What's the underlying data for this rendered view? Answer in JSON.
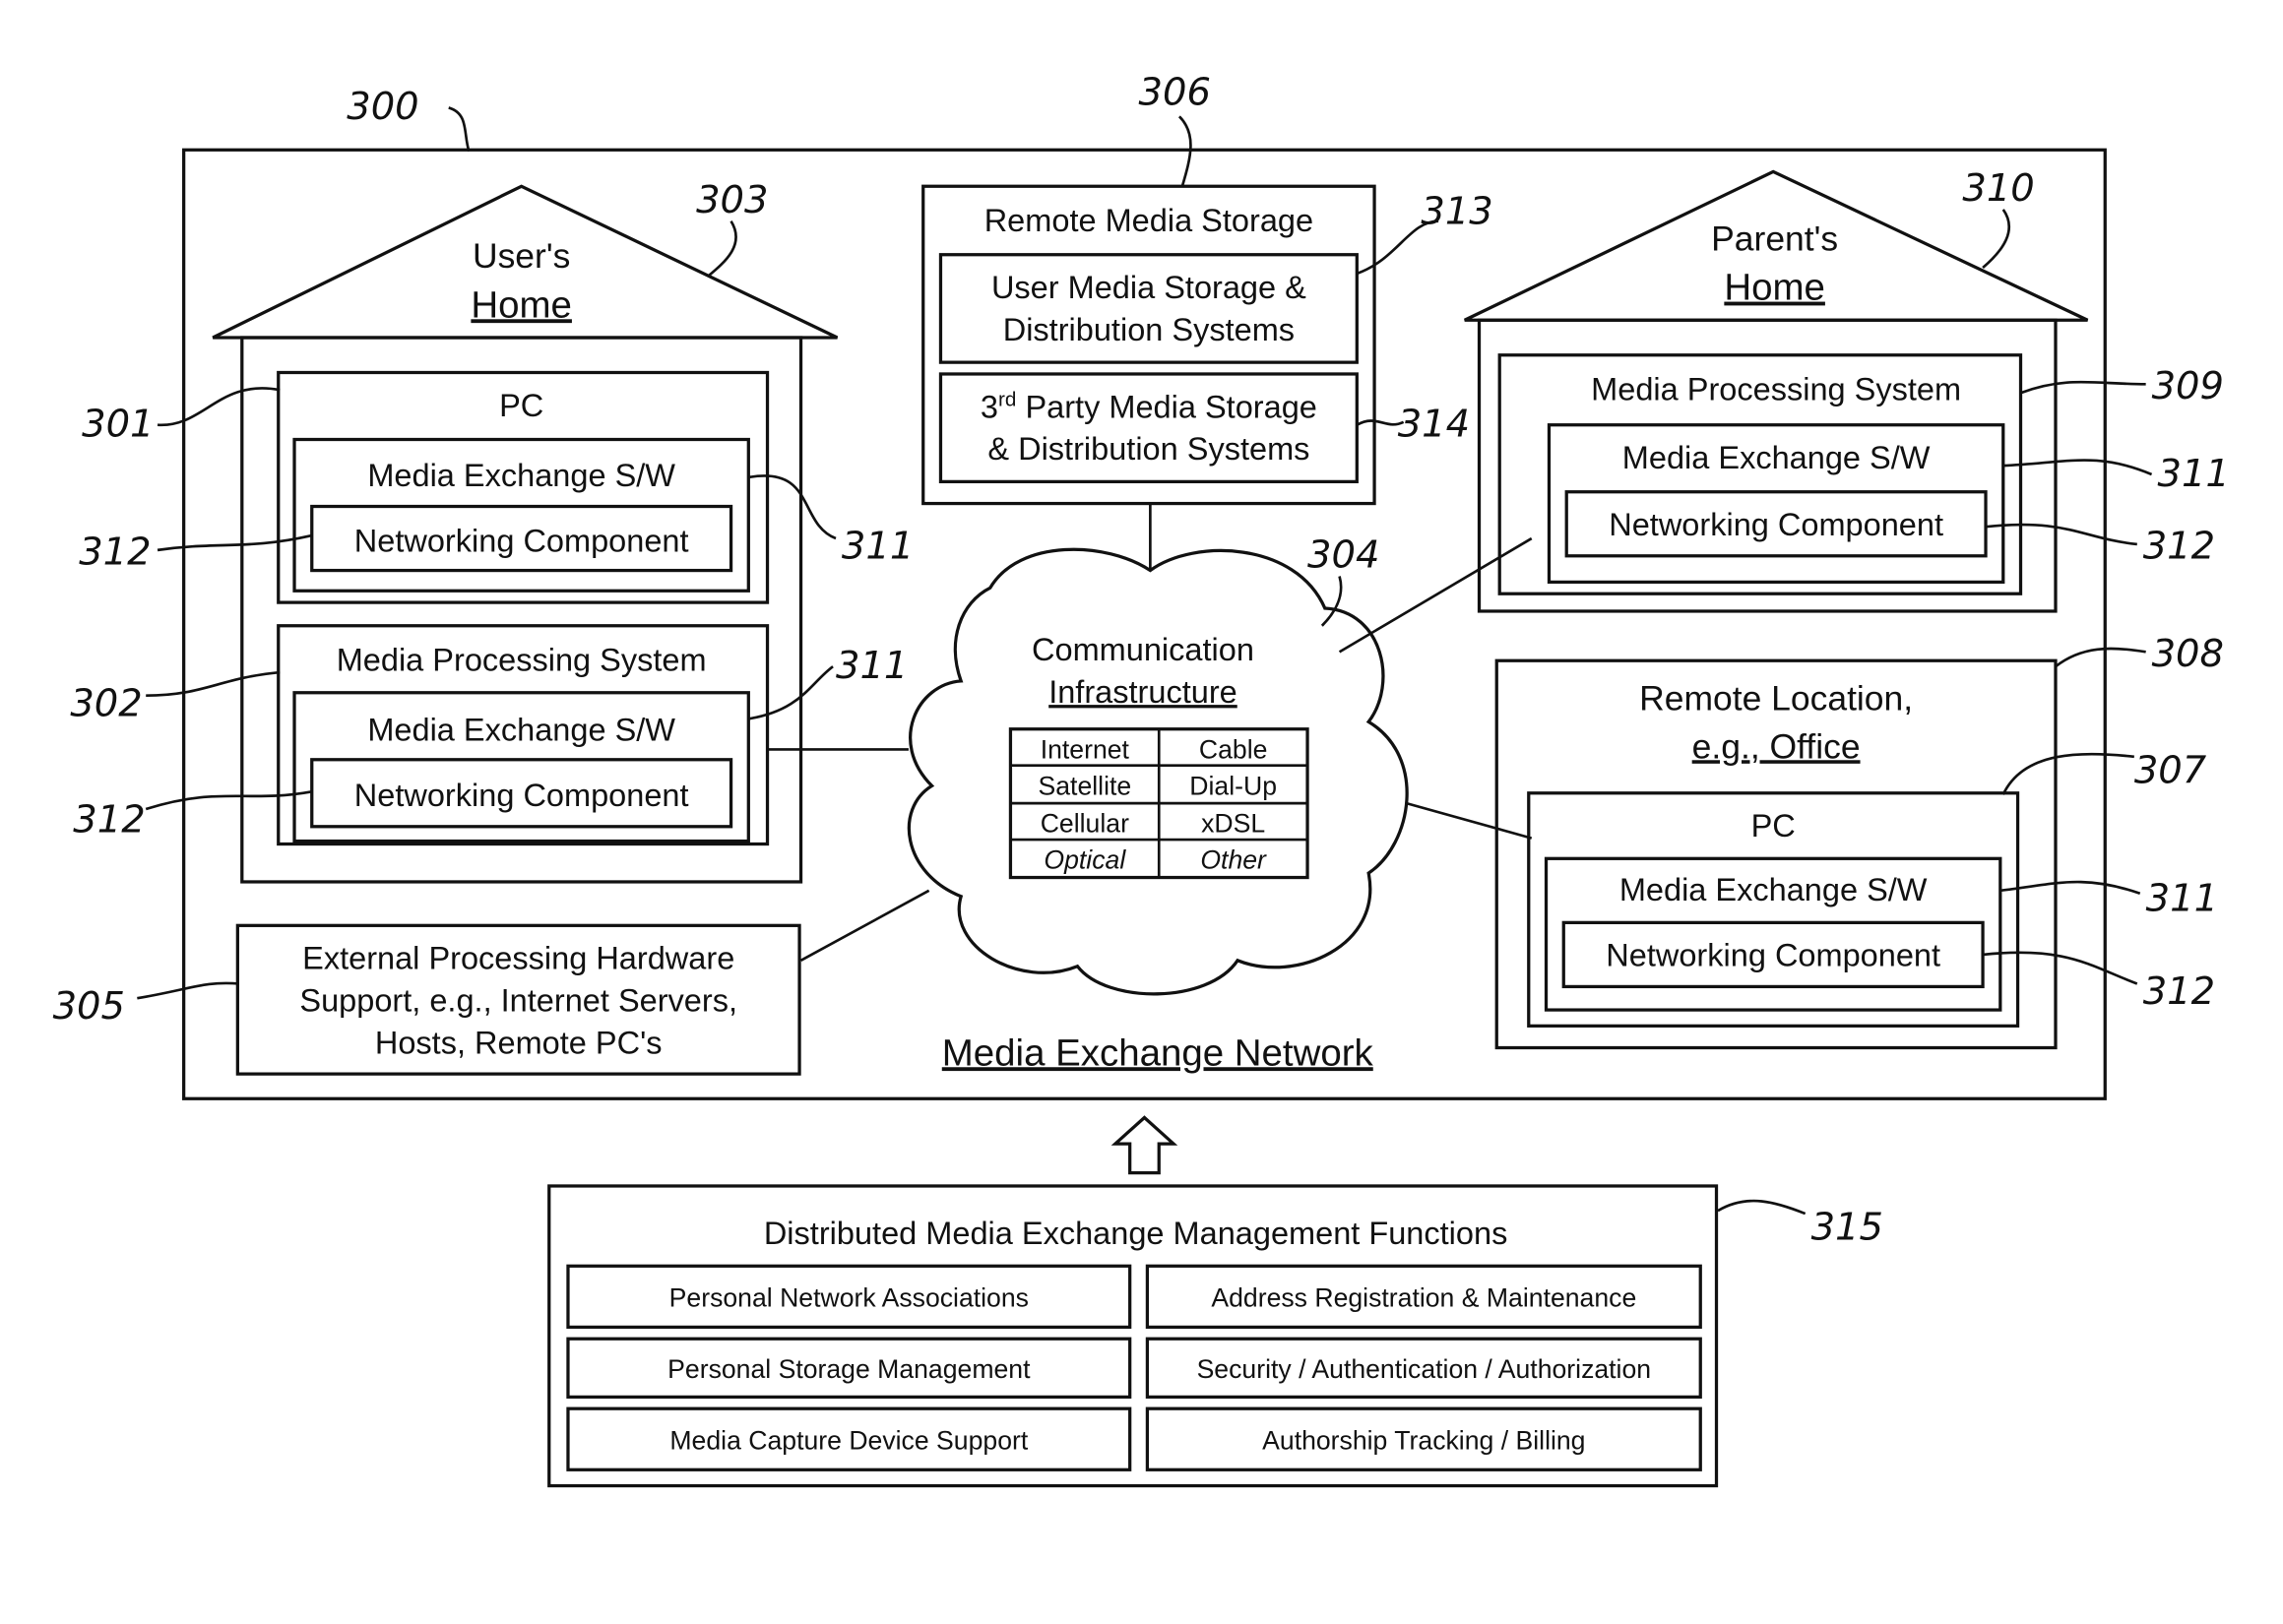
{
  "figure": {
    "outer_ref": "300",
    "network_title": "Media Exchange Network",
    "users_home": {
      "ref": "303",
      "title1": "User's",
      "title2": "Home",
      "pc": {
        "ref": "301",
        "title": "PC",
        "sw": "Media Exchange S/W",
        "sw_ref": "311",
        "net": "Networking Component",
        "net_ref": "312"
      },
      "mps": {
        "ref": "302",
        "title": "Media Processing System",
        "sw": "Media Exchange S/W",
        "sw_ref": "311",
        "net": "Networking Component",
        "net_ref": "312"
      }
    },
    "external": {
      "ref": "305",
      "line1": "External Processing Hardware",
      "line2": "Support, e.g., Internet Servers,",
      "line3": "Hosts, Remote PC's"
    },
    "remote_storage": {
      "ref": "306",
      "title": "Remote Media Storage",
      "user_line1": "User Media Storage &",
      "user_line2": "Distribution Systems",
      "user_ref": "313",
      "third_sup_pre": "3",
      "third_sup": "rd",
      "third_line1": " Party Media Storage",
      "third_line2": "& Distribution Systems",
      "third_ref": "314"
    },
    "cloud": {
      "ref": "304",
      "title1": "Communication",
      "title2": "Infrastructure",
      "cells": [
        [
          "Internet",
          "Cable"
        ],
        [
          "Satellite",
          "Dial-Up"
        ],
        [
          "Cellular",
          "xDSL"
        ],
        [
          "Optical",
          "Other"
        ]
      ]
    },
    "parents_home": {
      "ref": "310",
      "title1": "Parent's",
      "title2": "Home",
      "mps": {
        "ref": "309",
        "title": "Media Processing System",
        "sw": "Media Exchange S/W",
        "sw_ref": "311",
        "net": "Networking Component",
        "net_ref": "312"
      }
    },
    "remote_location": {
      "ref": "308",
      "title1": "Remote Location,",
      "title2": "e.g., Office",
      "pc": {
        "ref": "307",
        "title": "PC",
        "sw": "Media Exchange S/W",
        "sw_ref": "311",
        "net": "Networking Component",
        "net_ref": "312"
      }
    },
    "management": {
      "ref": "315",
      "title": "Distributed Media Exchange Management Functions",
      "items": [
        [
          "Personal Network Associations",
          "Address Registration & Maintenance"
        ],
        [
          "Personal Storage Management",
          "Security / Authentication / Authorization"
        ],
        [
          "Media Capture Device Support",
          "Authorship Tracking / Billing"
        ]
      ]
    }
  }
}
